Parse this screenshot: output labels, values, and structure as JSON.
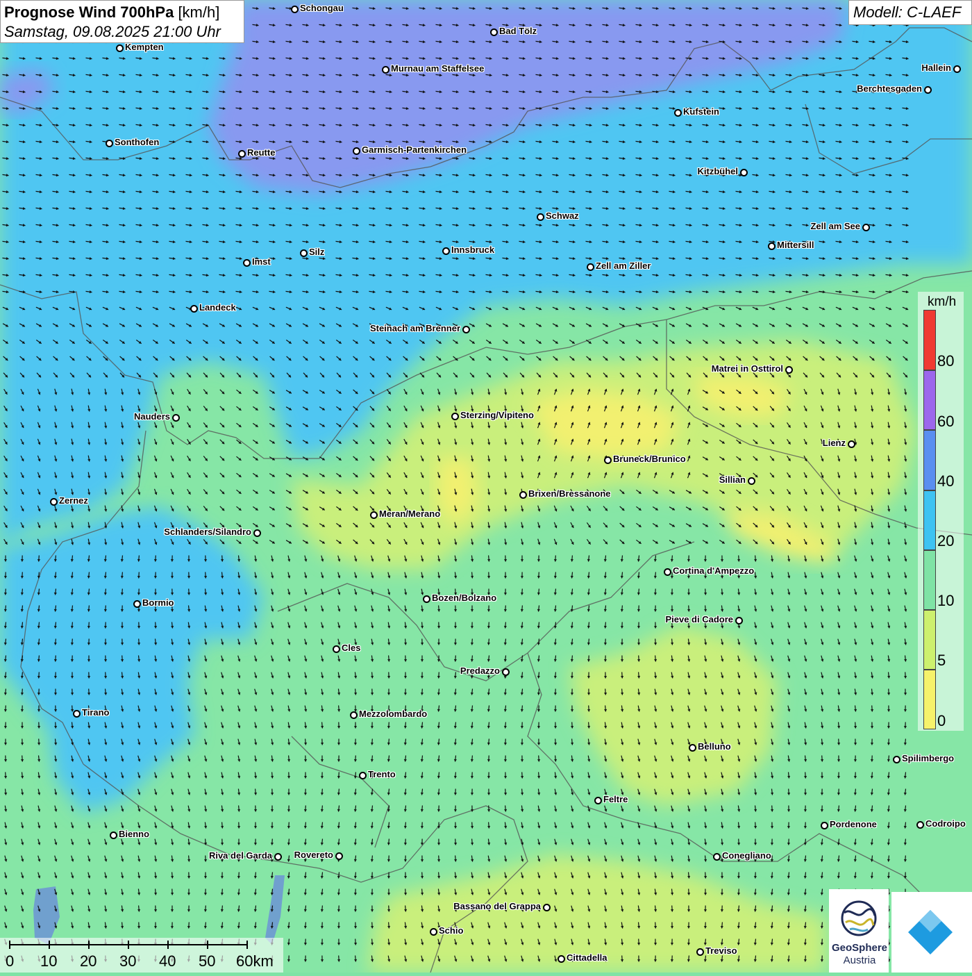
{
  "title": {
    "main": "Prognose Wind 700hPa",
    "unit": "[km/h]",
    "datetime": "Samstag, 09.08.2025 21:00 Uhr"
  },
  "model_label": "Modell: C-LAEF",
  "legend": {
    "unit": "km/h",
    "ticks": [
      "80",
      "60",
      "40",
      "20",
      "10",
      "5",
      "0"
    ],
    "bands": [
      {
        "from": 80,
        "color": "#f03a32"
      },
      {
        "from": 60,
        "color": "#9c67ec"
      },
      {
        "from": 40,
        "color": "#5a8ff0"
      },
      {
        "from": 20,
        "color": "#3ec3f2"
      },
      {
        "from": 10,
        "color": "#7fe3a5"
      },
      {
        "from": 5,
        "color": "#cdf06e"
      },
      {
        "from": 0,
        "color": "#f6f26a"
      }
    ]
  },
  "scale_bar": {
    "labels": [
      "0",
      "10",
      "20",
      "30",
      "40",
      "50",
      "60km"
    ]
  },
  "logos": {
    "geosphere_line1": "GeoSphere",
    "geosphere_line2": "Austria"
  },
  "colors": {
    "violet_wind": "#8899f0",
    "blue_wind": "#4fc6f2",
    "green_wind": "#86e6a6",
    "yellowgreen_wind": "#c9ef7c",
    "yellow_wind": "#f2f070"
  },
  "cities": [
    {
      "name": "Schongau"
    },
    {
      "name": "Bad Tölz"
    },
    {
      "name": "Kempten"
    },
    {
      "name": "Murnau am Staffelsee"
    },
    {
      "name": "Hallein"
    },
    {
      "name": "Berchtesgaden"
    },
    {
      "name": "Kufstein"
    },
    {
      "name": "Sonthofen"
    },
    {
      "name": "Reutte"
    },
    {
      "name": "Garmisch-Partenkirchen"
    },
    {
      "name": "Kitzbühel"
    },
    {
      "name": "Schwaz"
    },
    {
      "name": "Zell am See"
    },
    {
      "name": "Mittersill"
    },
    {
      "name": "Imst"
    },
    {
      "name": "Silz"
    },
    {
      "name": "Innsbruck"
    },
    {
      "name": "Zell am Ziller"
    },
    {
      "name": "Landeck"
    },
    {
      "name": "Steinach am Brenner"
    },
    {
      "name": "Matrei in Osttirol"
    },
    {
      "name": "Nauders"
    },
    {
      "name": "Sterzing/Vipiteno"
    },
    {
      "name": "Lienz"
    },
    {
      "name": "Bruneck/Brunico"
    },
    {
      "name": "Sillian"
    },
    {
      "name": "Zernez"
    },
    {
      "name": "Brixen/Bressanone"
    },
    {
      "name": "Meran/Merano"
    },
    {
      "name": "Schlanders/Silandro"
    },
    {
      "name": "Cortina d'Ampezzo"
    },
    {
      "name": "Bozen/Bolzano"
    },
    {
      "name": "Bormio"
    },
    {
      "name": "Pieve di Cadore"
    },
    {
      "name": "Cles"
    },
    {
      "name": "Predazzo"
    },
    {
      "name": "Tirano"
    },
    {
      "name": "Mezzolombardo"
    },
    {
      "name": "Belluno"
    },
    {
      "name": "Spilimbergo"
    },
    {
      "name": "Trento"
    },
    {
      "name": "Feltre"
    },
    {
      "name": "Bienno"
    },
    {
      "name": "Pordenone"
    },
    {
      "name": "Codroipo"
    },
    {
      "name": "Riva del Garda"
    },
    {
      "name": "Rovereto"
    },
    {
      "name": "Conegliano"
    },
    {
      "name": "Bassano del Grappa"
    },
    {
      "name": "Schio"
    },
    {
      "name": "Treviso"
    },
    {
      "name": "Cittadella"
    }
  ]
}
